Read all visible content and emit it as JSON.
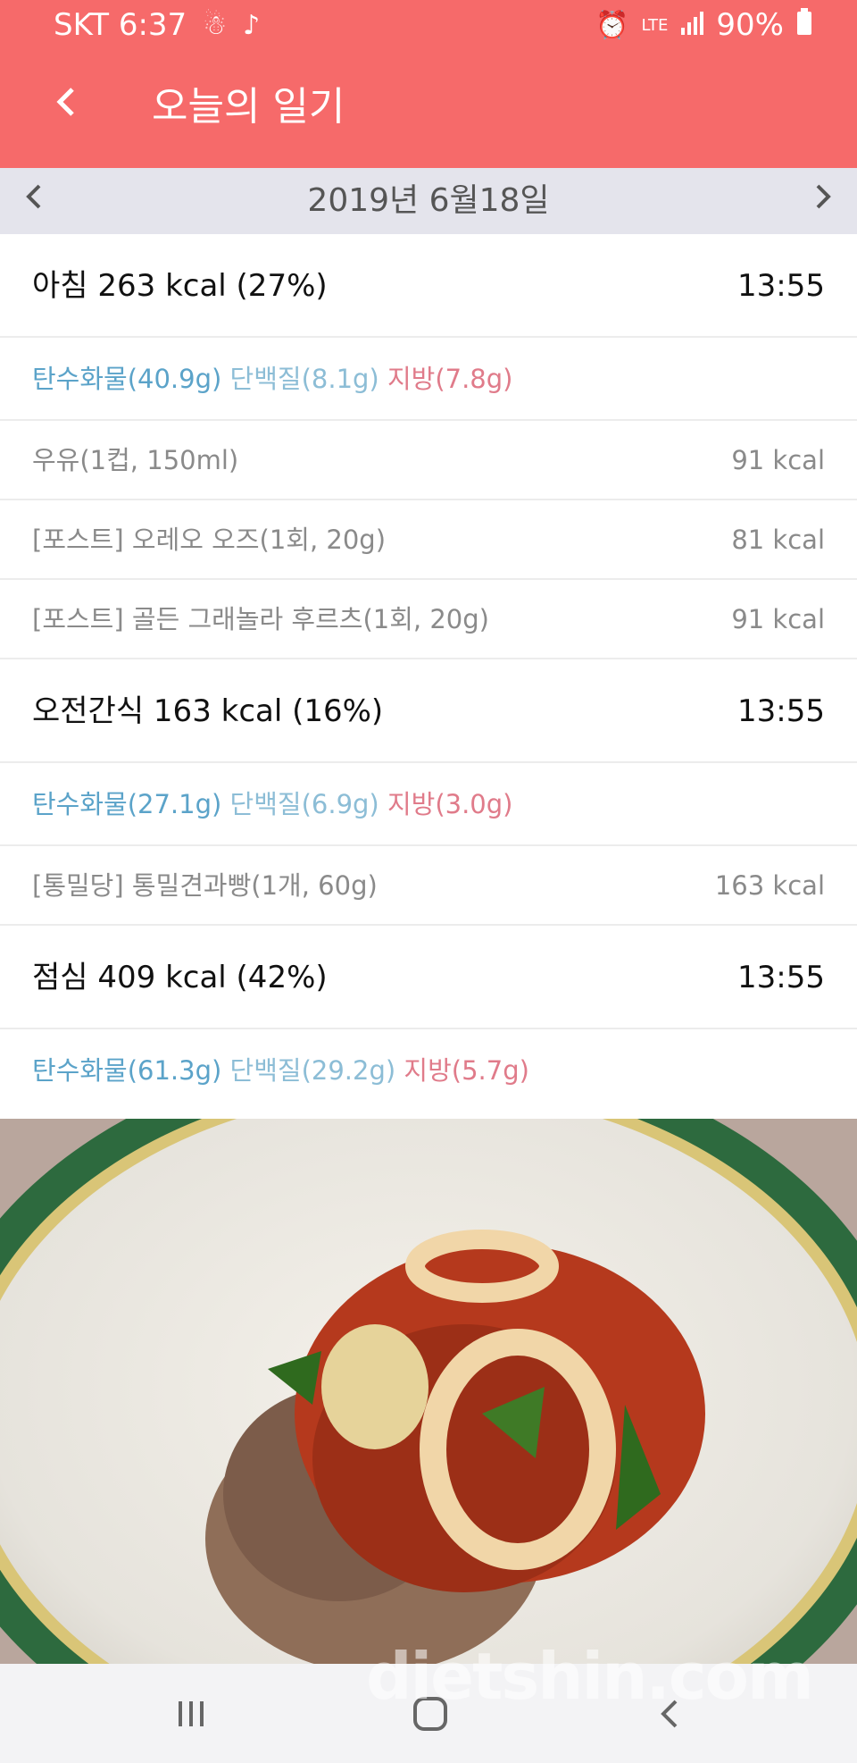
{
  "status": {
    "carrier_time": "SKT 6:37",
    "lte": "LTE",
    "battery": "90%"
  },
  "appbar": {
    "title": "오늘의 일기"
  },
  "date": {
    "label": "2019년 6월18일"
  },
  "meals": [
    {
      "title": "아침 263 kcal (27%)",
      "time": "13:55",
      "carb": "탄수화물(40.9g)",
      "protein": "단백질(8.1g)",
      "fat": "지방(7.8g)",
      "foods": [
        {
          "name": "우유(1컵, 150ml)",
          "kcal": "91 kcal"
        },
        {
          "name": "[포스트] 오레오 오즈(1회, 20g)",
          "kcal": "81 kcal"
        },
        {
          "name": "[포스트] 골든 그래놀라 후르츠(1회, 20g)",
          "kcal": "91 kcal"
        }
      ]
    },
    {
      "title": "오전간식 163 kcal (16%)",
      "time": "13:55",
      "carb": "탄수화물(27.1g)",
      "protein": "단백질(6.9g)",
      "fat": "지방(3.0g)",
      "foods": [
        {
          "name": "[통밀당] 통밀견과빵(1개, 60g)",
          "kcal": "163 kcal"
        }
      ]
    },
    {
      "title": "점심 409 kcal (42%)",
      "time": "13:55",
      "carb": "탄수화물(61.3g)",
      "protein": "단백질(29.2g)",
      "fat": "지방(5.7g)",
      "foods": []
    }
  ],
  "watermark": "dietshin.com",
  "colors": {
    "header": "#f66a6a",
    "datebar": "#e4e4ec",
    "carb": "#5ba3c9",
    "protein": "#8cbdd6",
    "fat": "#e07b8a"
  }
}
